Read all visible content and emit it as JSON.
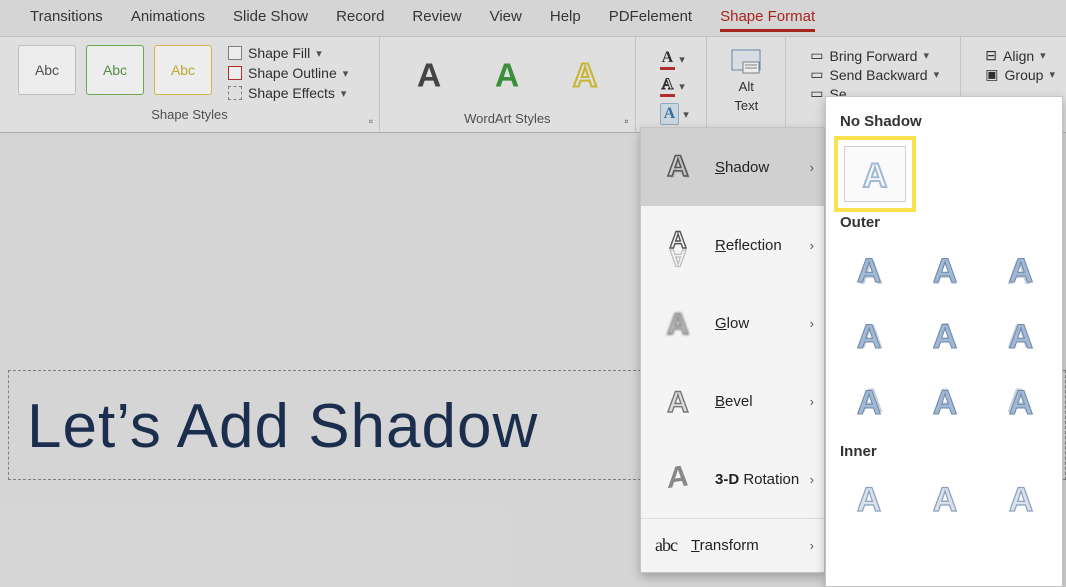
{
  "tabs": {
    "transitions": "Transitions",
    "animations": "Animations",
    "slideshow": "Slide Show",
    "record": "Record",
    "review": "Review",
    "view": "View",
    "help": "Help",
    "pdfelement": "PDFelement",
    "shapeformat": "Shape Format"
  },
  "shapeStyles": {
    "abc1": "Abc",
    "abc2": "Abc",
    "abc3": "Abc",
    "fill": "Shape Fill",
    "outline": "Shape Outline",
    "effects": "Shape Effects",
    "label": "Shape Styles"
  },
  "wordart": {
    "label": "WordArt Styles"
  },
  "alttext": {
    "line1": "Alt",
    "line2": "Text"
  },
  "arrange": {
    "bringfwd": "Bring Forward",
    "sendback": "Send Backward",
    "se": "Se",
    "align": "Align",
    "group": "Group"
  },
  "effects": {
    "shadow": "hadow",
    "shadow_pre": "S",
    "reflection": "eflection",
    "reflection_pre": "R",
    "glow": "low",
    "glow_pre": "G",
    "bevel": "evel",
    "bevel_pre": "B",
    "rotation": " Rotation",
    "rotation_pre": "3-D",
    "transform": "ransform",
    "transform_pre": "T"
  },
  "shadowPanel": {
    "noShadow": "No Shadow",
    "outer": "Outer",
    "inner": "Inner"
  },
  "slide": {
    "text": "Let’s Add Shadow "
  }
}
